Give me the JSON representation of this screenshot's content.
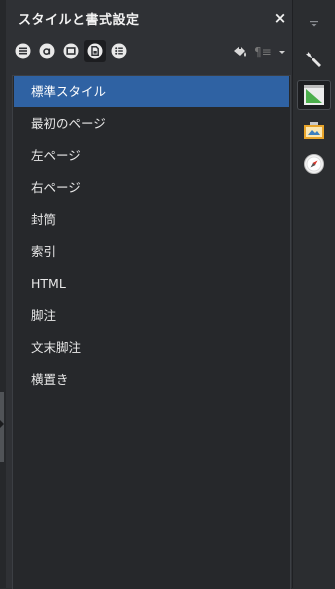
{
  "panel": {
    "title": "スタイルと書式設定",
    "close_symbol": "×"
  },
  "toolbar": {
    "buttons": [
      {
        "icon": "paragraph-styles-icon"
      },
      {
        "icon": "character-styles-icon"
      },
      {
        "icon": "frame-styles-icon"
      },
      {
        "icon": "page-styles-icon",
        "active": true
      },
      {
        "icon": "list-styles-icon"
      }
    ],
    "fill_format_icon": "fill-format-mode-icon",
    "new_style_symbol": "¶≡",
    "dropdown_icon": "chevron-down-icon"
  },
  "styles_list": {
    "items": [
      {
        "label": "標準スタイル",
        "selected": true
      },
      {
        "label": "最初のページ"
      },
      {
        "label": "左ページ"
      },
      {
        "label": "右ページ"
      },
      {
        "label": "封筒"
      },
      {
        "label": "索引"
      },
      {
        "label": "HTML"
      },
      {
        "label": "脚注"
      },
      {
        "label": "文末脚注"
      },
      {
        "label": "横置き"
      }
    ]
  },
  "sidebar": {
    "items": [
      {
        "icon": "wrench-icon"
      },
      {
        "icon": "styles-deck-icon",
        "active": true
      },
      {
        "icon": "gallery-icon"
      },
      {
        "icon": "navigator-compass-icon"
      }
    ]
  },
  "colors": {
    "selection": "#2f62a3",
    "panel_bg": "#2f3135",
    "list_bg": "#26282b"
  }
}
